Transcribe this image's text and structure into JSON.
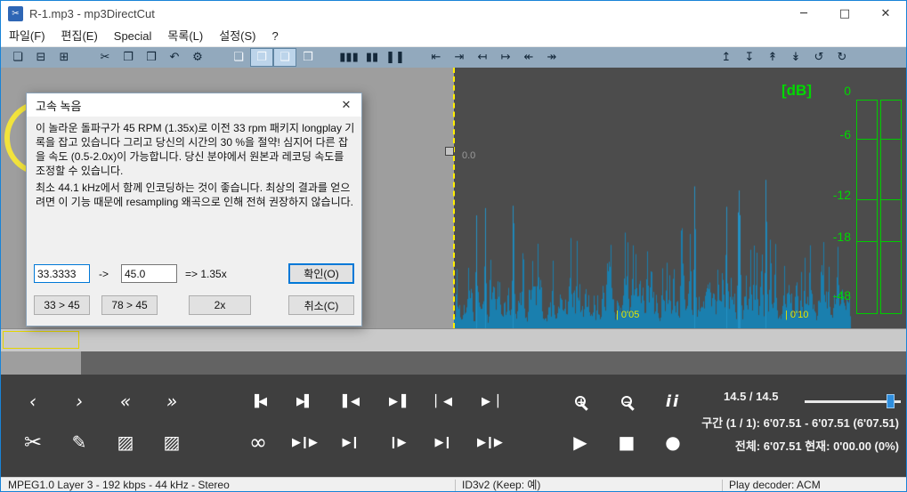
{
  "window": {
    "title": "R-1.mp3 - mp3DirectCut",
    "icon_glyph": "✂",
    "minimize": "─",
    "maximize": "□",
    "close": "✕"
  },
  "menu": {
    "items": [
      {
        "name": "file-menu",
        "label": "파일(F)"
      },
      {
        "name": "edit-menu",
        "label": "편집(E)"
      },
      {
        "name": "special-menu",
        "label": "Special"
      },
      {
        "name": "list-menu",
        "label": "목록(L)"
      },
      {
        "name": "settings-menu",
        "label": "설정(S)"
      },
      {
        "name": "help-menu",
        "label": "?"
      }
    ]
  },
  "toolbar": {
    "items": [
      {
        "name": "open-icon",
        "glyph": "❏"
      },
      {
        "name": "save-icon",
        "glyph": "⊟"
      },
      {
        "name": "save-split-icon",
        "glyph": "⊞"
      },
      {
        "name": "cut-icon",
        "glyph": "✂",
        "cls": "gap"
      },
      {
        "name": "copy-icon",
        "glyph": "❐"
      },
      {
        "name": "paste-icon",
        "glyph": "❒"
      },
      {
        "name": "undo-icon",
        "glyph": "↶"
      },
      {
        "name": "settings-gear-icon",
        "glyph": "⚙"
      },
      {
        "name": "doc-info-icon",
        "glyph": "❏",
        "cls": "gap doc"
      },
      {
        "name": "doc-id3-icon",
        "glyph": "❐",
        "cls": "doc pressed"
      },
      {
        "name": "doc-vbr-icon",
        "glyph": "❑",
        "cls": "doc pressed"
      },
      {
        "name": "doc-list-icon",
        "glyph": "❒",
        "cls": "doc"
      },
      {
        "name": "vu-bars-icon",
        "glyph": "▮▮▮",
        "cls": "gap"
      },
      {
        "name": "vu-half-icon",
        "glyph": "▮▮"
      },
      {
        "name": "pause-detect-icon",
        "glyph": "❚❚"
      },
      {
        "name": "cue-in-icon",
        "glyph": "⇤",
        "cls": "gap"
      },
      {
        "name": "cue-out-icon",
        "glyph": "⇥"
      },
      {
        "name": "mark-left-icon",
        "glyph": "↤"
      },
      {
        "name": "mark-right-icon",
        "glyph": "↦"
      },
      {
        "name": "jump-left-icon",
        "glyph": "↞"
      },
      {
        "name": "jump-right-icon",
        "glyph": "↠"
      },
      {
        "name": "auto-cue-icon",
        "glyph": "↥",
        "cls": "gap-xl"
      },
      {
        "name": "pause-scan-icon",
        "glyph": "↧"
      },
      {
        "name": "gain-up-icon",
        "glyph": "↟"
      },
      {
        "name": "gain-down-icon",
        "glyph": "↡"
      },
      {
        "name": "loop-tool-icon",
        "glyph": "↺"
      },
      {
        "name": "redo-tool-icon",
        "glyph": "↻"
      }
    ]
  },
  "dialog": {
    "title": "고속 녹음",
    "close_glyph": "✕",
    "body1": "이 놀라운 돌파구가 45 RPM (1.35x)로 이전 33 rpm 패키지 longplay 기록을 잡고 있습니다 그리고 당신의 시간의 30 %을 절약! 심지어 다른 잡을 속도 (0.5-2.0x)이 가능합니다. 당신 분야에서 원본과 레코딩 속도를 조정할 수 있습니다.",
    "body2": "최소 44.1 kHz에서 함께 인코딩하는 것이 좋습니다. 최상의 결과를 얻으려면 이 기능 때문에 resampling 왜곡으로 인해 전혀 권장하지 않습니다.",
    "rpm_from": "33.3333",
    "arrow_label": "->",
    "rpm_to": "45.0",
    "ratio_label": "=> 1.35x",
    "ok_label": "확인(O)",
    "preset_33_45": "33 > 45",
    "preset_78_45": "78 > 45",
    "preset_2x": "2x",
    "cancel_label": "취소(C)"
  },
  "wave": {
    "cursor_label": "0.0",
    "db_label": "[dB]",
    "db_ticks": [
      {
        "label": "0"
      },
      {
        "label": "-6"
      },
      {
        "label": "-12"
      },
      {
        "label": "-18"
      },
      {
        "label": "-48"
      }
    ],
    "time_labels": [
      {
        "name": "time-label-0-05",
        "label": "| 0'05"
      },
      {
        "name": "time-label-0-10",
        "label": "| 0'10"
      }
    ]
  },
  "transport": {
    "zoom_value": "14.5  /  14.5",
    "range_line": "구간 (1 / 1): 6'07.51 - 6'07.51  (6'07.51)",
    "total_line": "전체: 6'07.51   현재: 0'00.00   (0%)",
    "row1": [
      {
        "name": "step-back-icon",
        "glyph": "‹"
      },
      {
        "name": "step-forward-icon",
        "glyph": "›"
      },
      {
        "name": "skip-back-icon",
        "glyph": "«"
      },
      {
        "name": "skip-forward-icon",
        "glyph": "»"
      },
      {
        "name": "sel-start-left-icon",
        "glyph": "▐◀",
        "cls": "sep sm"
      },
      {
        "name": "sel-start-right-icon",
        "glyph": "▶▌",
        "cls": "sm"
      },
      {
        "name": "sel-end-left-icon",
        "glyph": "▌◀",
        "cls": "sm"
      },
      {
        "name": "sel-end-right-icon",
        "glyph": "▶▐",
        "cls": "sm"
      },
      {
        "name": "goto-start-icon",
        "glyph": "▏◀",
        "cls": "sm"
      },
      {
        "name": "goto-end-icon",
        "glyph": "▶▕",
        "cls": "sm"
      },
      {
        "name": "zoom-in-icon",
        "glyph": "+",
        "cls": "sep2 mag"
      },
      {
        "name": "zoom-out-icon",
        "glyph": "−",
        "cls": "mag"
      },
      {
        "name": "track-info-icon",
        "glyph": "ii",
        "cls": "info"
      }
    ],
    "row2": [
      {
        "name": "scissors-cut-icon",
        "glyph": "✂",
        "cls": "big"
      },
      {
        "name": "pencil-edit-icon",
        "glyph": "✎"
      },
      {
        "name": "sel-begin-hatch-icon",
        "glyph": "▨"
      },
      {
        "name": "sel-end-hatch-icon",
        "glyph": "▨"
      },
      {
        "name": "loop-icon",
        "glyph": "∞",
        "cls": "sep big"
      },
      {
        "name": "play-around-cut-icon",
        "glyph": "▶❙▶",
        "cls": "sm"
      },
      {
        "name": "play-to-cut-icon",
        "glyph": "▶❙",
        "cls": "sm"
      },
      {
        "name": "play-from-sel-icon",
        "glyph": "❙▶",
        "cls": "sm"
      },
      {
        "name": "play-to-sel-icon",
        "glyph": "▶❙",
        "cls": "sm"
      },
      {
        "name": "play-skip-icon",
        "glyph": "▶❙▶",
        "cls": "sm"
      },
      {
        "name": "play-icon",
        "glyph": "▶",
        "cls": "sep2"
      },
      {
        "name": "stop-icon",
        "glyph": "■"
      },
      {
        "name": "record-icon",
        "glyph": "●"
      }
    ]
  },
  "status": {
    "format": "MPEG1.0 Layer 3 - 192 kbps - 44 kHz - Stereo",
    "id3": "ID3v2 (Keep: 예)",
    "decoder": "Play decoder: ACM"
  }
}
